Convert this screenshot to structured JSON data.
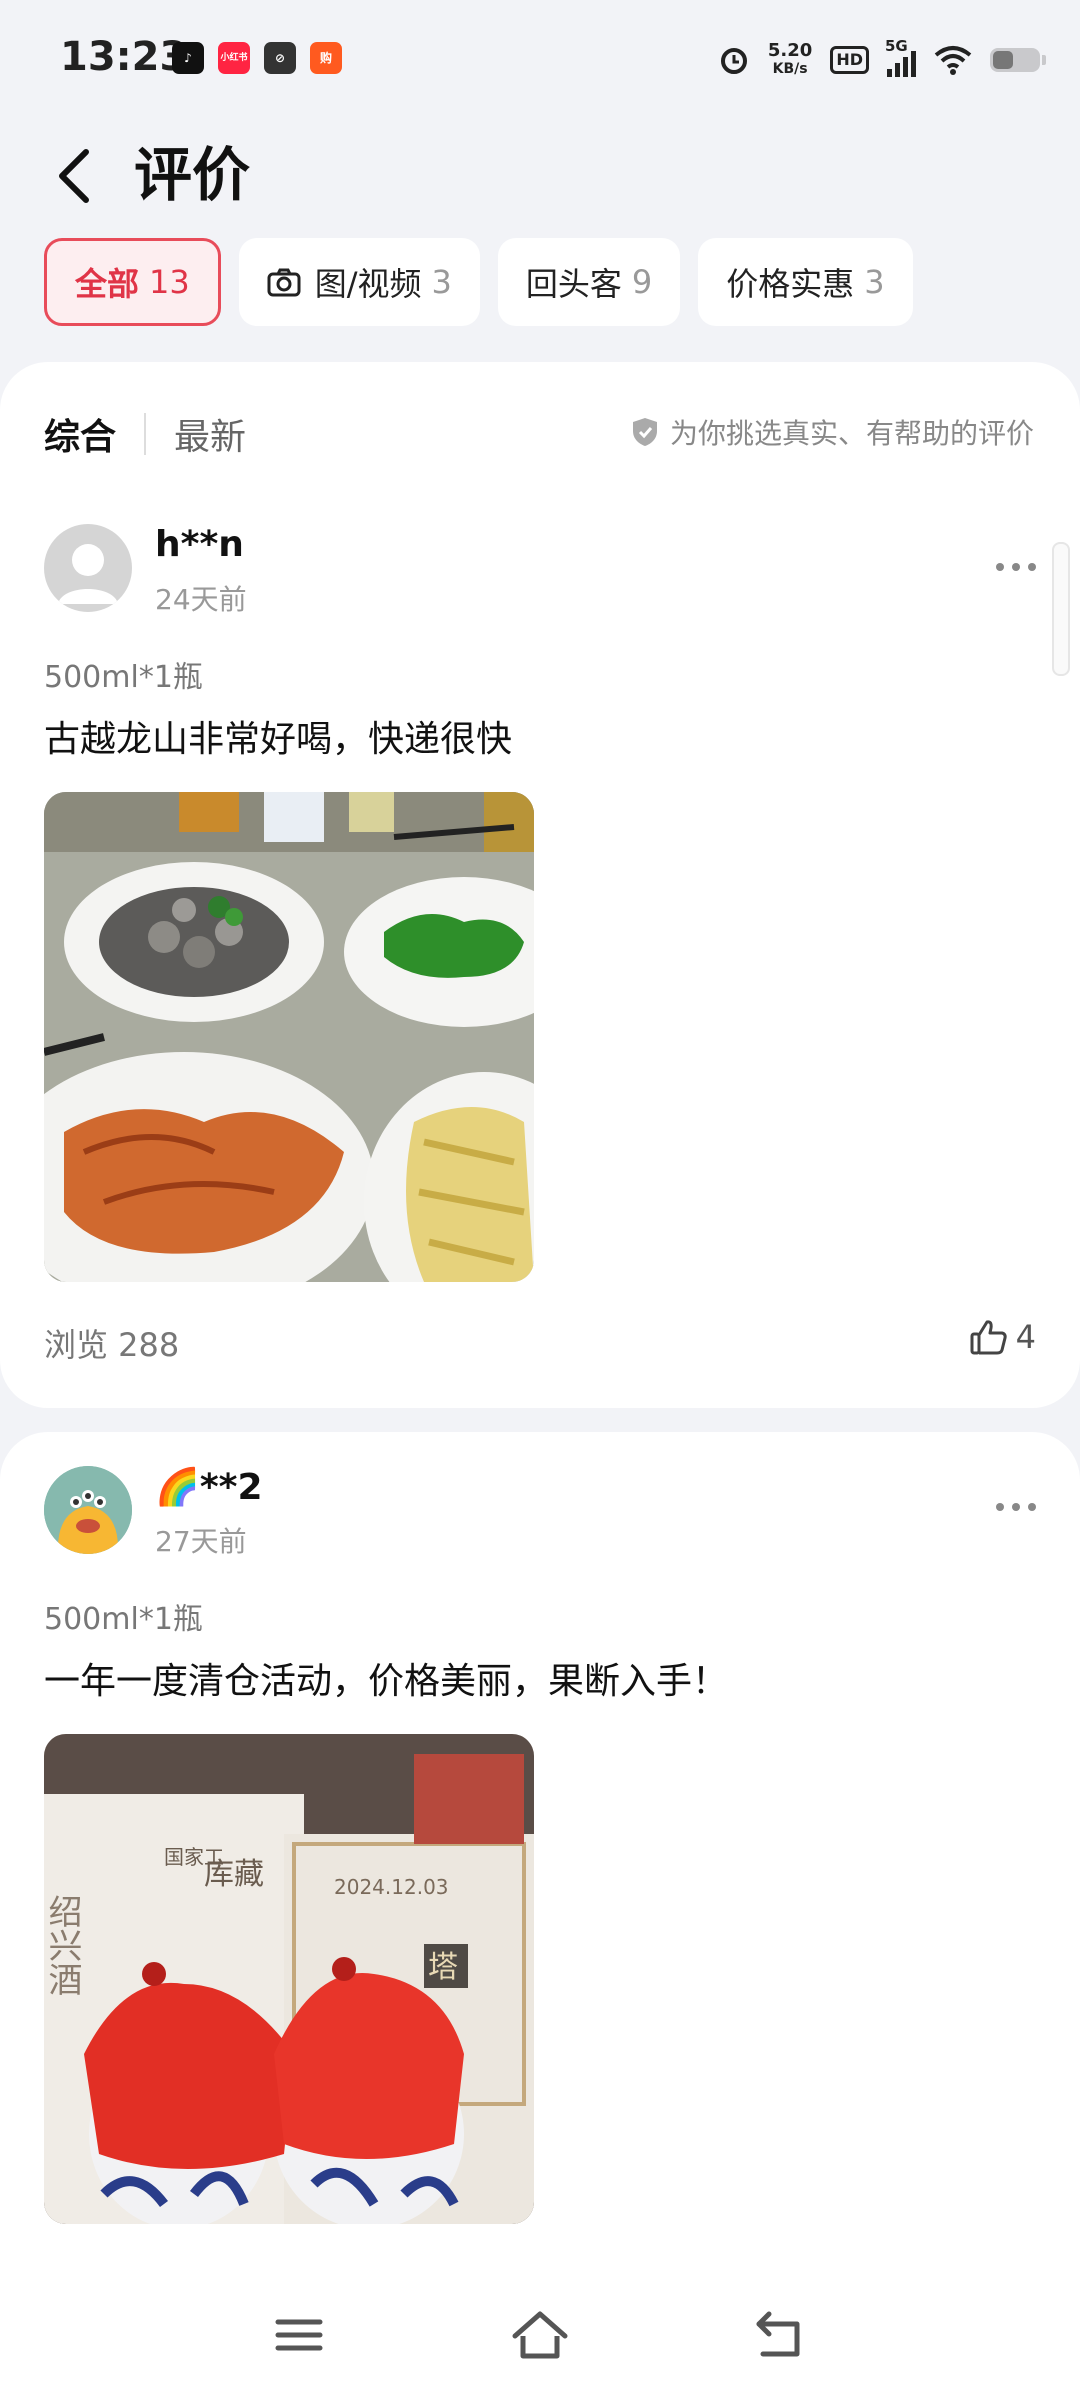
{
  "status_bar": {
    "time": "13:23",
    "apps": [
      {
        "icon": "tiktok-icon",
        "label": "♪",
        "color": "#111111"
      },
      {
        "icon": "xiaohongshu-icon",
        "label": "小红书",
        "color": "#ff2442"
      },
      {
        "icon": "app-link-icon",
        "label": "⊘",
        "color": "#333333"
      },
      {
        "icon": "shopping-app-icon",
        "label": "购",
        "color": "#ff5a1f"
      }
    ],
    "net_speed_value": "5.20",
    "net_speed_unit": "KB/s",
    "hd_label": "HD",
    "signal_label": "5G",
    "battery_icon": "battery-icon"
  },
  "header": {
    "title": "评价",
    "back_icon": "back-arrow-icon"
  },
  "filters": [
    {
      "label": "全部",
      "count": "13",
      "active": true
    },
    {
      "label": "图/视频",
      "count": "3",
      "active": false,
      "icon": "camera-icon"
    },
    {
      "label": "回头客",
      "count": "9",
      "active": false
    },
    {
      "label": "价格实惠",
      "count": "3",
      "active": false
    }
  ],
  "sort": {
    "options": [
      "综合",
      "最新"
    ],
    "selected": "综合",
    "note": "为你挑选真实、有帮助的评价",
    "note_icon": "shield-icon"
  },
  "reviews": [
    {
      "user": "h**n",
      "time": "24天前",
      "sku": "500ml*1瓶",
      "text": "古越龙山非常好喝，快递很快",
      "views": "浏览 288",
      "likes": "4",
      "avatar": "default-avatar-icon",
      "photo": "food-photo"
    },
    {
      "user": "🌈**2",
      "time": "27天前",
      "sku": "500ml*1瓶",
      "text": "一年一度清仓活动，价格美丽，果断入手！",
      "avatar": "monster-avatar-icon",
      "photo": "wine-bottles-photo",
      "photo_text": {
        "box1_line1": "库藏",
        "box1_line2": "国家工",
        "box1_side": "绍兴酒",
        "box2_date": "2024.12.03",
        "box2_seal": "塔"
      }
    }
  ],
  "colors": {
    "accent": "#e03447",
    "background": "#f2f3f7"
  },
  "nav": {
    "menu_icon": "menu-icon",
    "home_icon": "home-icon",
    "back_icon": "return-icon"
  }
}
